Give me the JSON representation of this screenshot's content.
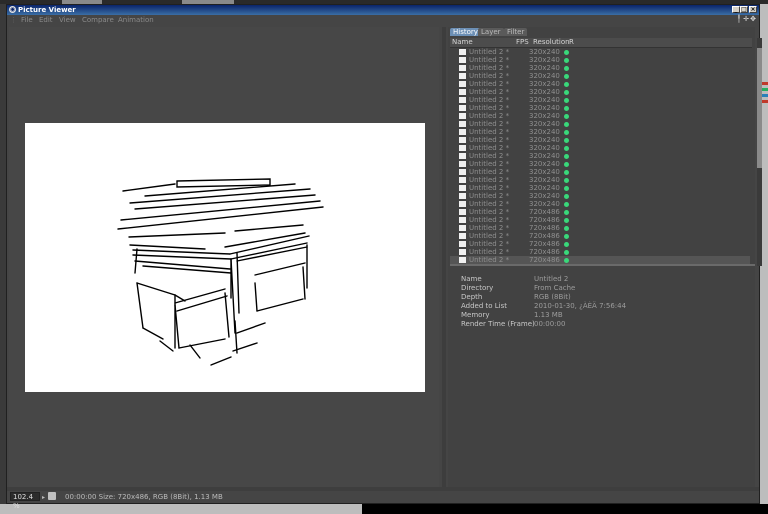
{
  "window": {
    "title": "Picture Viewer",
    "minimize": "_",
    "maximize": "□",
    "close": "×"
  },
  "menu": [
    "File",
    "Edit",
    "View",
    "Compare",
    "Animation"
  ],
  "panel": {
    "tabs": [
      "History",
      "Layer",
      "Filter"
    ],
    "columns": {
      "name": "Name",
      "fps": "FPS",
      "resolution": "Resolution",
      "r": "R"
    },
    "history": [
      {
        "name": "Untitled 2 *",
        "res": "320x240"
      },
      {
        "name": "Untitled 2 *",
        "res": "320x240"
      },
      {
        "name": "Untitled 2 *",
        "res": "320x240"
      },
      {
        "name": "Untitled 2 *",
        "res": "320x240"
      },
      {
        "name": "Untitled 2 *",
        "res": "320x240"
      },
      {
        "name": "Untitled 2 *",
        "res": "320x240"
      },
      {
        "name": "Untitled 2 *",
        "res": "320x240"
      },
      {
        "name": "Untitled 2 *",
        "res": "320x240"
      },
      {
        "name": "Untitled 2 *",
        "res": "320x240"
      },
      {
        "name": "Untitled 2 *",
        "res": "320x240"
      },
      {
        "name": "Untitled 2 *",
        "res": "320x240"
      },
      {
        "name": "Untitled 2 *",
        "res": "320x240"
      },
      {
        "name": "Untitled 2 *",
        "res": "320x240"
      },
      {
        "name": "Untitled 2 *",
        "res": "320x240"
      },
      {
        "name": "Untitled 2 *",
        "res": "320x240"
      },
      {
        "name": "Untitled 2 *",
        "res": "320x240"
      },
      {
        "name": "Untitled 2 *",
        "res": "320x240"
      },
      {
        "name": "Untitled 2 *",
        "res": "320x240"
      },
      {
        "name": "Untitled 2 *",
        "res": "320x240"
      },
      {
        "name": "Untitled 2 *",
        "res": "320x240"
      },
      {
        "name": "Untitled 2 *",
        "res": "720x486"
      },
      {
        "name": "Untitled 2 *",
        "res": "720x486"
      },
      {
        "name": "Untitled 2 *",
        "res": "720x486"
      },
      {
        "name": "Untitled 2 *",
        "res": "720x486"
      },
      {
        "name": "Untitled 2 *",
        "res": "720x486"
      },
      {
        "name": "Untitled 2 *",
        "res": "720x486"
      },
      {
        "name": "Untitled 2 *",
        "res": "720x486"
      }
    ],
    "info": [
      {
        "key": "Name",
        "value": "Untitled 2"
      },
      {
        "key": "Directory",
        "value": "From Cache"
      },
      {
        "key": "Depth",
        "value": "RGB (8Bit)"
      },
      {
        "key": "Added to List",
        "value": "2010-01-30, ¿ÀÈÄ 7:56:44"
      },
      {
        "key": "Memory",
        "value": "1.13 MB"
      },
      {
        "key": "Render Time (Frame)",
        "value": "00:00:00"
      }
    ]
  },
  "status": {
    "zoom": "102.4 %",
    "zoom_arrow": "▸",
    "text": "00:00:00  Size: 720x486, RGB (8Bit), 1.13 MB"
  },
  "icons": {
    "app": "picture-viewer-icon",
    "tool1": "╿",
    "tool2": "✛",
    "tool3": "✥"
  },
  "colors": {
    "render_dot": "#39d87a",
    "active_tab": "#6c8fb5",
    "title_gradient_start": "#0a246a"
  }
}
